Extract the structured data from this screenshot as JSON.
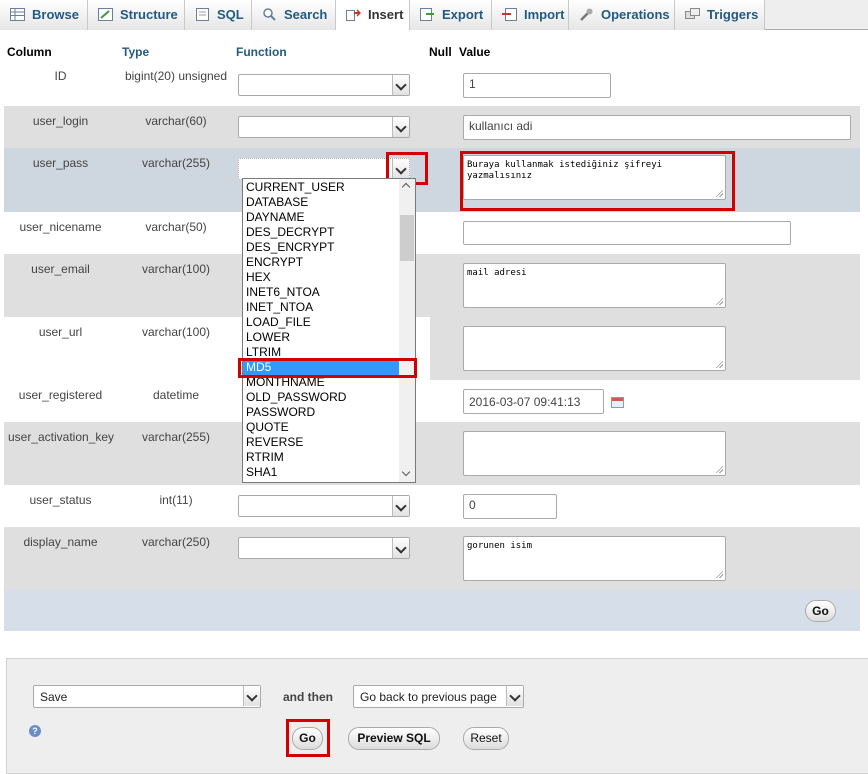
{
  "tabs": [
    {
      "label": "Browse",
      "icon": "browse-icon"
    },
    {
      "label": "Structure",
      "icon": "structure-icon"
    },
    {
      "label": "SQL",
      "icon": "sql-icon"
    },
    {
      "label": "Search",
      "icon": "search-icon"
    },
    {
      "label": "Insert",
      "icon": "insert-icon",
      "active": true
    },
    {
      "label": "Export",
      "icon": "export-icon"
    },
    {
      "label": "Import",
      "icon": "import-icon"
    },
    {
      "label": "Operations",
      "icon": "operations-icon"
    },
    {
      "label": "Triggers",
      "icon": "triggers-icon"
    }
  ],
  "table": {
    "headers": {
      "column": "Column",
      "type": "Type",
      "function": "Function",
      "null": "Null",
      "value": "Value"
    },
    "rows": [
      {
        "column": "ID",
        "type": "bigint(20) unsigned",
        "value": "1"
      },
      {
        "column": "user_login",
        "type": "varchar(60)",
        "value": "kullanıcı adi"
      },
      {
        "column": "user_pass",
        "type": "varchar(255)",
        "value": "Buraya kullanmak istediğiniz şifreyi yazmalısınız"
      },
      {
        "column": "user_nicename",
        "type": "varchar(50)",
        "value": ""
      },
      {
        "column": "user_email",
        "type": "varchar(100)",
        "value": "mail adresi"
      },
      {
        "column": "user_url",
        "type": "varchar(100)",
        "value": ""
      },
      {
        "column": "user_registered",
        "type": "datetime",
        "value": "2016-03-07 09:41:13"
      },
      {
        "column": "user_activation_key",
        "type": "varchar(255)",
        "value": ""
      },
      {
        "column": "user_status",
        "type": "int(11)",
        "value": "0"
      },
      {
        "column": "display_name",
        "type": "varchar(250)",
        "value": "gorunen isim"
      }
    ],
    "go_label": "Go"
  },
  "function_dropdown": {
    "selected": "MD5",
    "options": [
      "CURRENT_USER",
      "DATABASE",
      "DAYNAME",
      "DES_DECRYPT",
      "DES_ENCRYPT",
      "ENCRYPT",
      "HEX",
      "INET6_NTOA",
      "INET_NTOA",
      "LOAD_FILE",
      "LOWER",
      "LTRIM",
      "MD5",
      "MONTHNAME",
      "OLD_PASSWORD",
      "PASSWORD",
      "QUOTE",
      "REVERSE",
      "RTRIM",
      "SHA1"
    ]
  },
  "bottom": {
    "action_select": "Save",
    "and_then": "and then",
    "after_select": "Go back to previous page",
    "go_label": "Go",
    "preview_label": "Preview SQL",
    "reset_label": "Reset"
  },
  "colors": {
    "highlight": "#d40000",
    "link": "#235a81",
    "selected_option": "#3399ff"
  }
}
